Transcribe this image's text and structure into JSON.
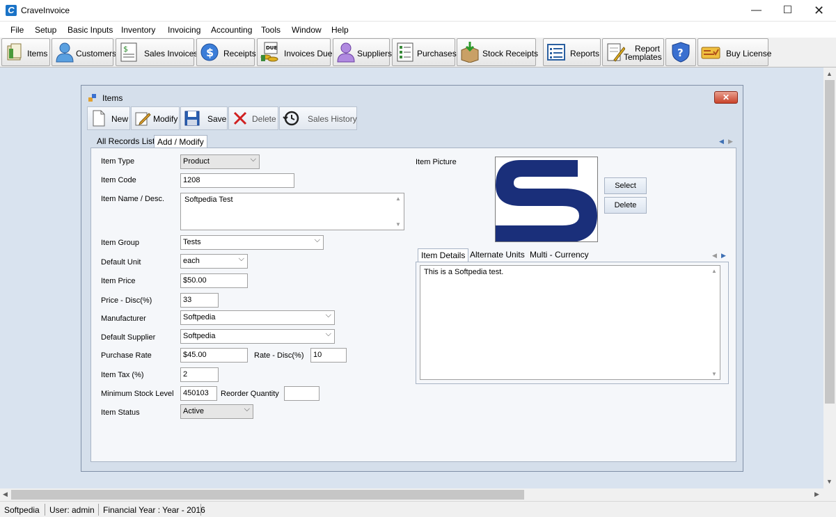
{
  "app": {
    "title": "CraveInvoice",
    "icon_letter": "C"
  },
  "window_controls": {
    "minimize": "—",
    "maximize": "☐",
    "close": "✕"
  },
  "menu": [
    "File",
    "Setup",
    "Basic Inputs",
    "Inventory",
    "Invoicing",
    "Accounting",
    "Tools",
    "Window",
    "Help"
  ],
  "toolbar": {
    "items": "Items",
    "customers": "Customers",
    "sales_invoices": "Sales Invoices",
    "receipts": "Receipts",
    "invoices_due": "Invoices Due",
    "suppliers": "Suppliers",
    "purchases": "Purchases",
    "stock_receipts": "Stock Receipts",
    "reports": "Reports",
    "report_templates_1": "Report",
    "report_templates_2": "Templates",
    "buy_license": "Buy License",
    "due_badge": "DUE"
  },
  "child_window": {
    "title": "Items",
    "close": "✕",
    "toolbar": {
      "new": "New",
      "modify": "Modify",
      "save": "Save",
      "delete": "Delete",
      "sales_history": "Sales History"
    },
    "tabs": [
      "All Records List",
      "Add / Modify"
    ],
    "form": {
      "item_type": {
        "label": "Item Type",
        "value": "Product"
      },
      "item_code": {
        "label": "Item Code",
        "value": "1208"
      },
      "item_name": {
        "label": "Item Name / Desc.",
        "value": "Softpedia Test"
      },
      "item_group": {
        "label": "Item Group",
        "value": "Tests"
      },
      "default_unit": {
        "label": "Default Unit",
        "value": "each"
      },
      "item_price": {
        "label": "Item Price",
        "value": "$50.00"
      },
      "price_disc": {
        "label": "Price - Disc(%)",
        "value": "33"
      },
      "manufacturer": {
        "label": "Manufacturer",
        "value": "Softpedia"
      },
      "default_supplier": {
        "label": "Default Supplier",
        "value": "Softpedia"
      },
      "purchase_rate": {
        "label": "Purchase Rate",
        "value": "$45.00"
      },
      "rate_disc": {
        "label": "Rate - Disc(%)",
        "value": "10"
      },
      "item_tax": {
        "label": "Item Tax (%)",
        "value": "2"
      },
      "min_stock": {
        "label": "Minimum Stock Level",
        "value": "450103"
      },
      "reorder_qty": {
        "label": "Reorder Quantity",
        "value": ""
      },
      "item_status": {
        "label": "Item Status",
        "value": "Active"
      }
    },
    "picture": {
      "label": "Item Picture",
      "select": "Select",
      "delete": "Delete"
    },
    "detail_tabs": [
      "Item Details",
      "Alternate Units",
      "Multi - Currency"
    ],
    "item_details_text": "This is a Softpedia test."
  },
  "status": {
    "company": "Softpedia",
    "user": "User: admin",
    "financial_year": "Financial Year : Year - 2016"
  },
  "colors": {
    "workspace": "#d9e3ef",
    "logo_blue": "#1a2f7a",
    "accent_blue": "#1a73c7"
  }
}
